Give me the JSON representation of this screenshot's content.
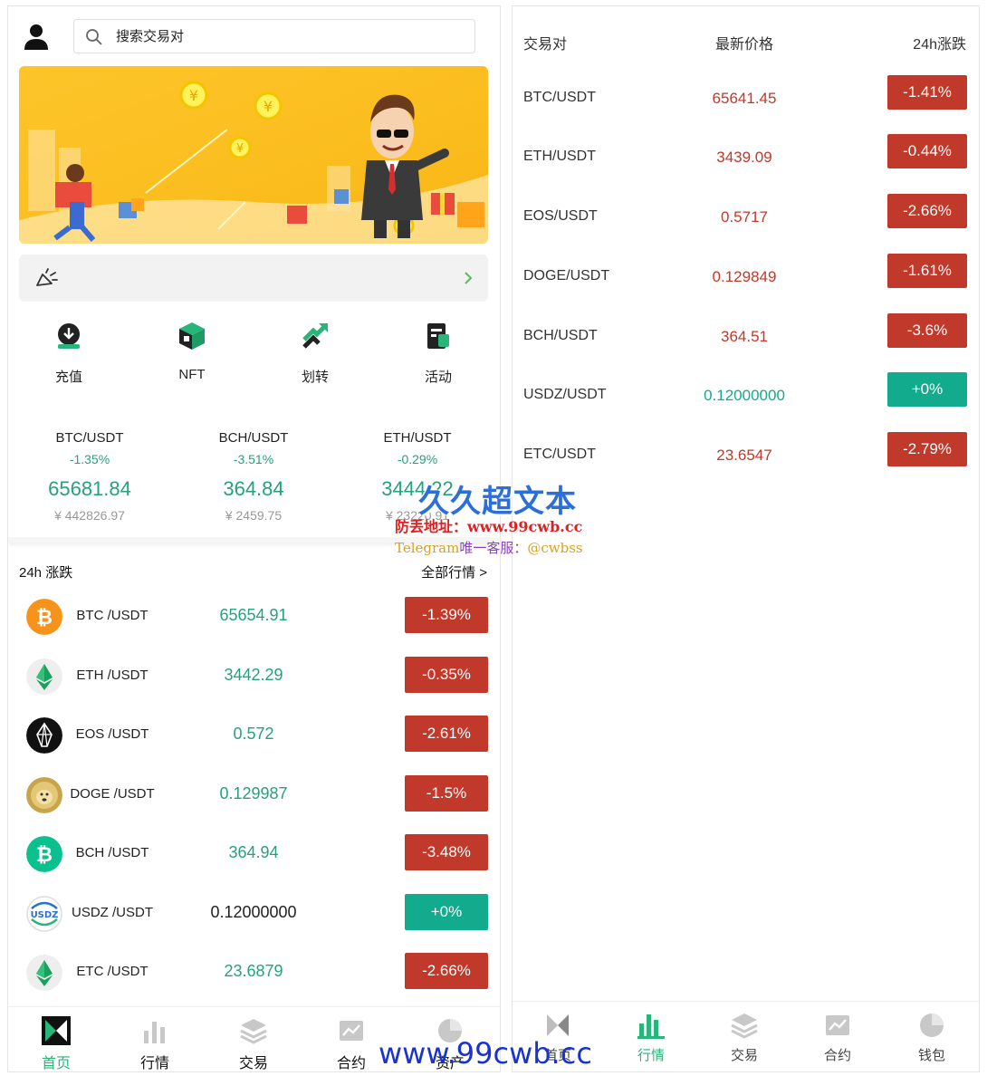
{
  "colors": {
    "up": "#12ab8e",
    "down": "#c0392b",
    "accent": "#26a17b",
    "banner": "#fbbd1e"
  },
  "search": {
    "placeholder": "搜索交易对"
  },
  "quick_nav": [
    {
      "label": "充值",
      "icon": "deposit-icon"
    },
    {
      "label": "NFT",
      "icon": "nft-cube-icon"
    },
    {
      "label": "划转",
      "icon": "transfer-icon"
    },
    {
      "label": "活动",
      "icon": "activity-icon"
    }
  ],
  "tickers": [
    {
      "pair": "BTC/USDT",
      "change": "-1.35%",
      "price": "65681.84",
      "cny": "¥ 442826.97"
    },
    {
      "pair": "BCH/USDT",
      "change": "-3.51%",
      "price": "364.84",
      "cny": "¥ 2459.75"
    },
    {
      "pair": "ETH/USDT",
      "change": "-0.29%",
      "price": "3444.22",
      "cny": "¥ 23220.91"
    }
  ],
  "section": {
    "title": "24h 涨跌",
    "more": "全部行情 >"
  },
  "list": [
    {
      "pair": "BTC /USDT",
      "price": "65654.91",
      "change": "-1.39%",
      "icon": "btc-icon"
    },
    {
      "pair": "ETH /USDT",
      "price": "3442.29",
      "change": "-0.35%",
      "icon": "eth-icon"
    },
    {
      "pair": "EOS /USDT",
      "price": "0.572",
      "change": "-2.61%",
      "icon": "eos-icon"
    },
    {
      "pair": "DOGE /USDT",
      "price": "0.129987",
      "change": "-1.5%",
      "icon": "doge-icon"
    },
    {
      "pair": "BCH /USDT",
      "price": "364.94",
      "change": "-3.48%",
      "icon": "bch-icon"
    },
    {
      "pair": "USDZ /USDT",
      "price": "0.12000000",
      "change": "+0%",
      "icon": "usdz-icon"
    },
    {
      "pair": "ETC /USDT",
      "price": "23.6879",
      "change": "-2.66%",
      "icon": "etc-icon"
    }
  ],
  "tabbar_left": [
    {
      "label": "首页",
      "icon": "home-logo-icon",
      "active": true
    },
    {
      "label": "行情",
      "icon": "bar-chart-icon",
      "active": false
    },
    {
      "label": "交易",
      "icon": "layers-icon",
      "active": false
    },
    {
      "label": "合约",
      "icon": "trend-chart-icon",
      "active": false
    },
    {
      "label": "资产",
      "icon": "pie-chart-icon",
      "active": false
    }
  ],
  "market": {
    "headers": [
      "交易对",
      "最新价格",
      "24h涨跌"
    ],
    "rows": [
      {
        "pair": "BTC/USDT",
        "price": "65641.45",
        "change": "-1.41%"
      },
      {
        "pair": "ETH/USDT",
        "price": "3439.09",
        "change": "-0.44%"
      },
      {
        "pair": "EOS/USDT",
        "price": "0.5717",
        "change": "-2.66%"
      },
      {
        "pair": "DOGE/USDT",
        "price": "0.129849",
        "change": "-1.61%"
      },
      {
        "pair": "BCH/USDT",
        "price": "364.51",
        "change": "-3.6%"
      },
      {
        "pair": "USDZ/USDT",
        "price": "0.12000000",
        "change": "+0%"
      },
      {
        "pair": "ETC/USDT",
        "price": "23.6547",
        "change": "-2.79%"
      }
    ]
  },
  "tabbar_right": [
    {
      "label": "首页",
      "icon": "home-logo-icon",
      "active": false
    },
    {
      "label": "行情",
      "icon": "bar-chart-icon",
      "active": true
    },
    {
      "label": "交易",
      "icon": "layers-icon",
      "active": false
    },
    {
      "label": "合约",
      "icon": "trend-chart-icon",
      "active": false
    },
    {
      "label": "钱包",
      "icon": "pie-chart-icon",
      "active": false
    }
  ],
  "watermark": {
    "title": "久久超文本",
    "address": "防丢地址：www.99cwb.cc",
    "telegram_prefix": "Telegram",
    "telegram_mid": "唯一客服：",
    "telegram_handle": "@cwbss",
    "url": "www.99cwb.cc"
  }
}
